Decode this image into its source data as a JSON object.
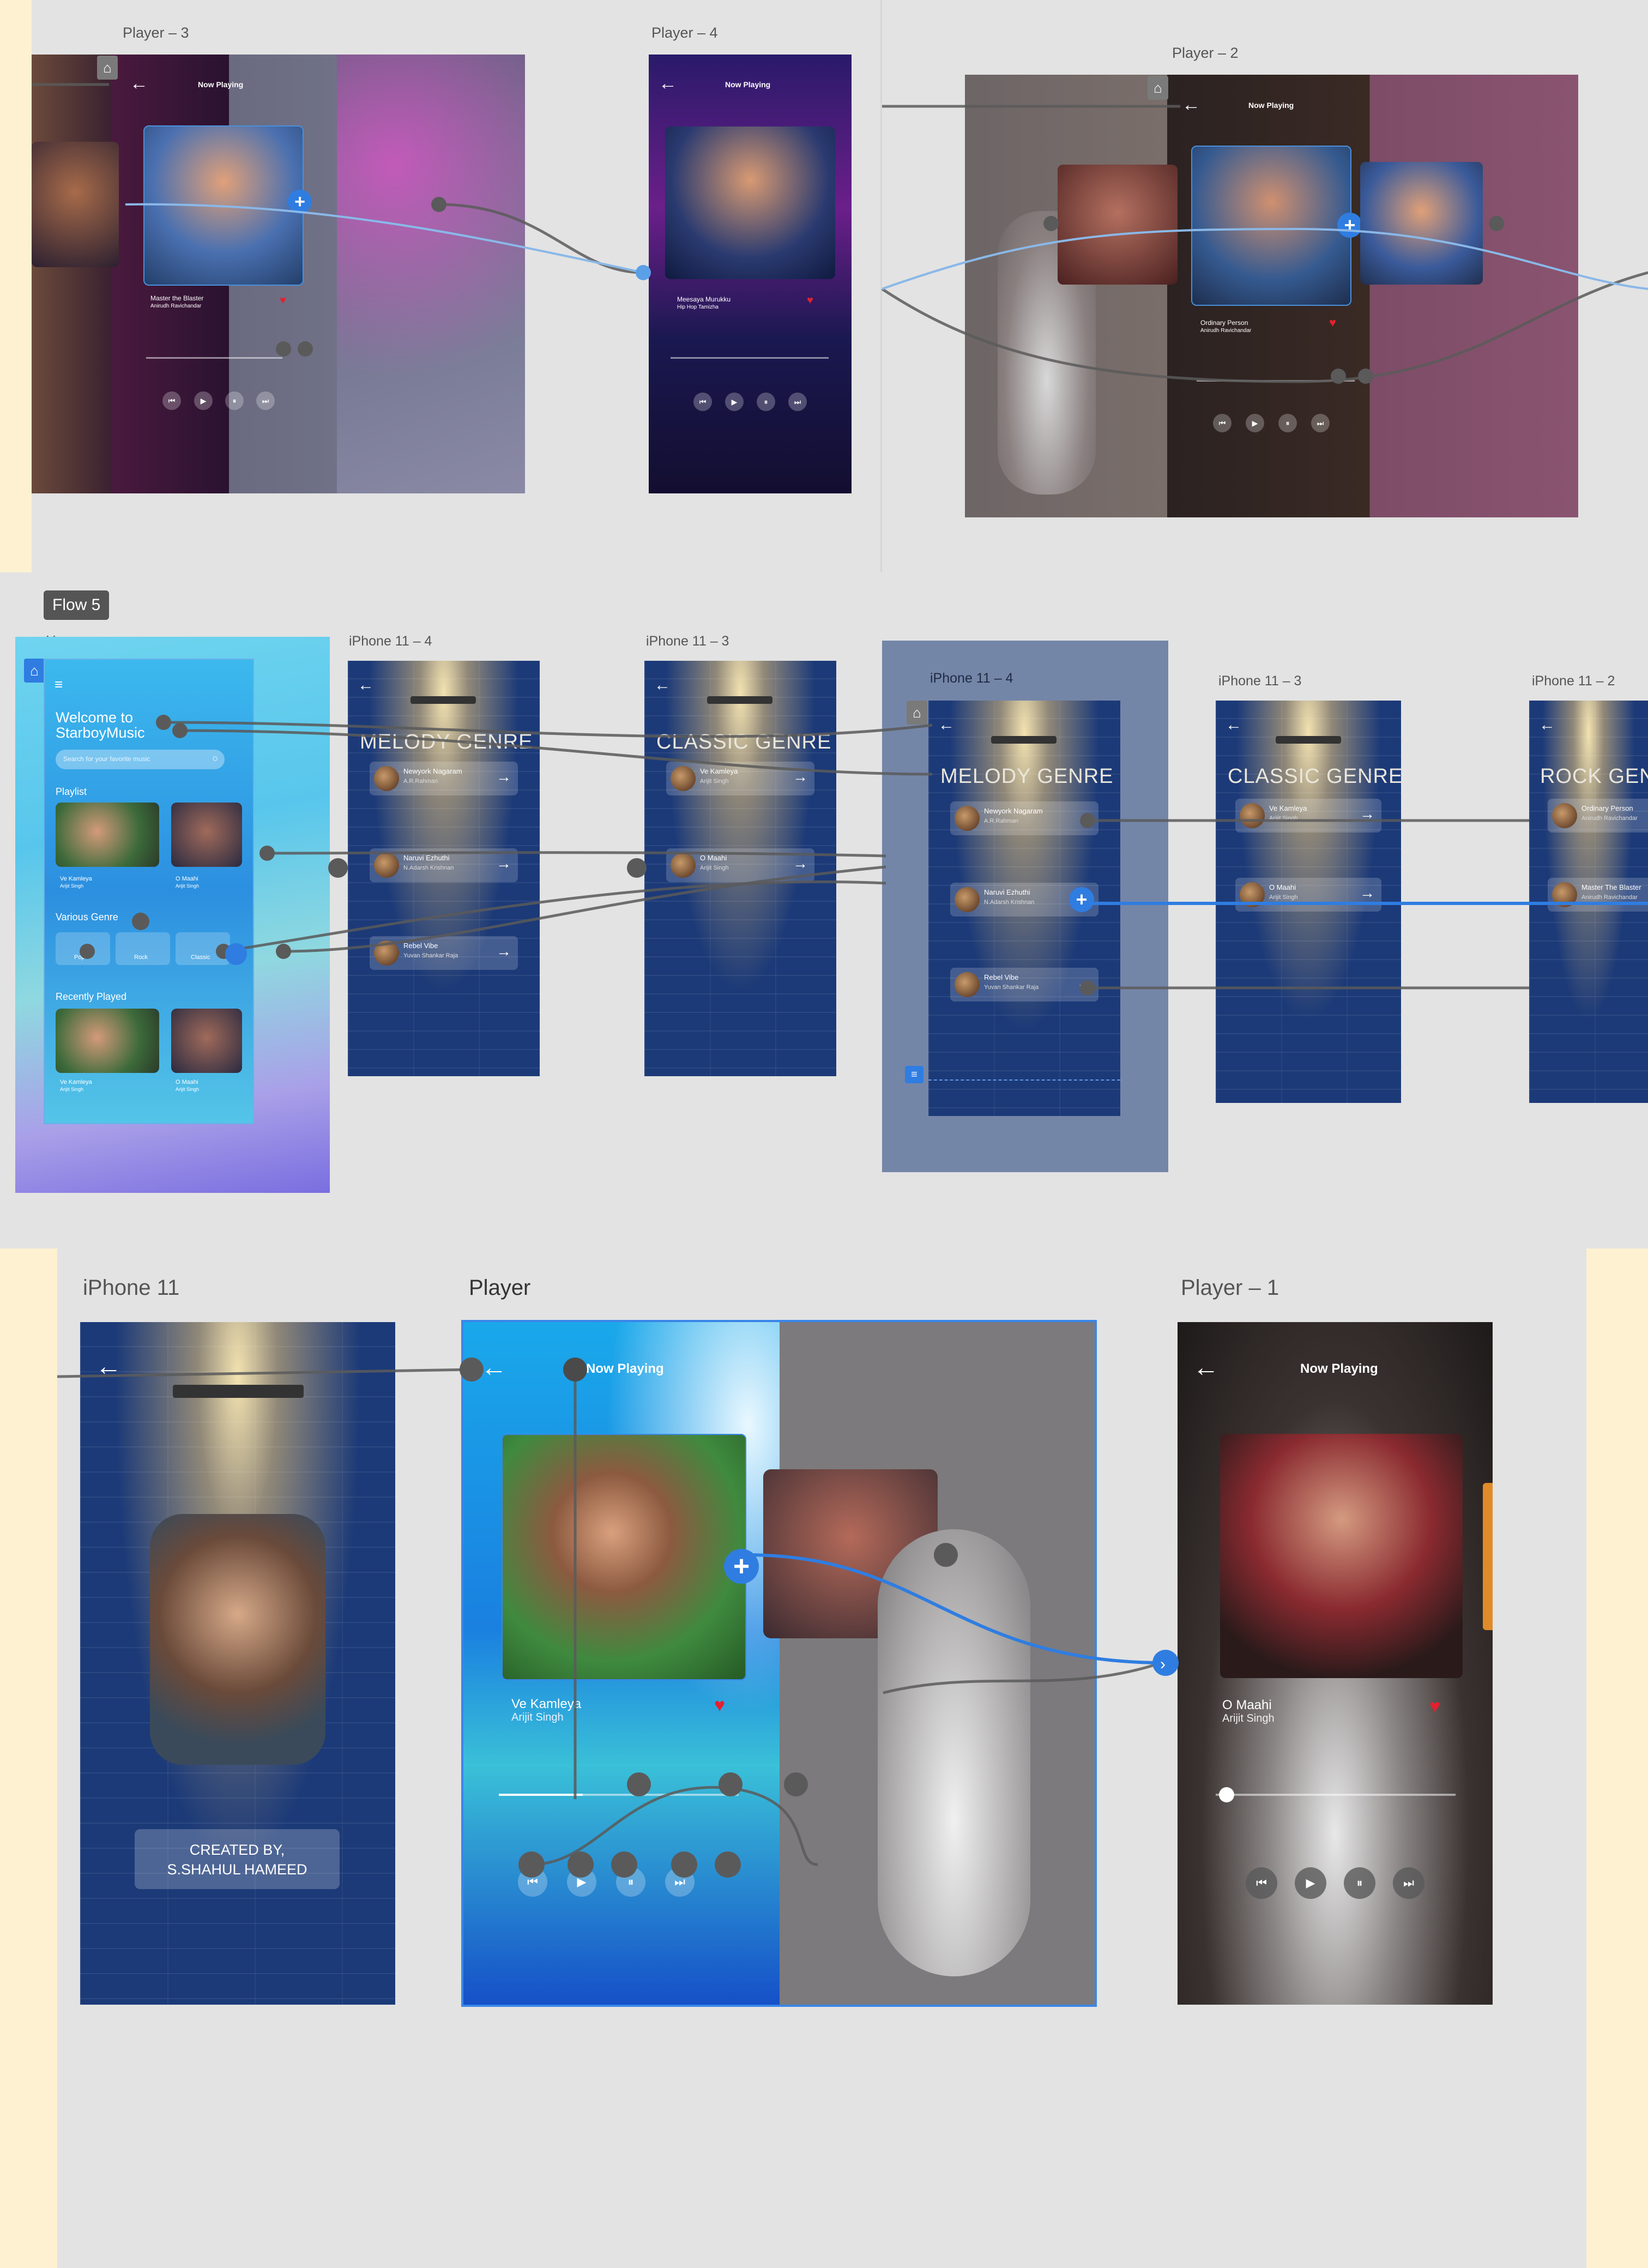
{
  "labels": {
    "player3": "Player – 3",
    "player4": "Player – 4",
    "player2": "Player – 2",
    "flow": "Flow 5",
    "home": "Home",
    "iphone11_4a": "iPhone 11 – 4",
    "iphone11_3a": "iPhone 11 – 3",
    "iphone11_4b": "iPhone 11 – 4",
    "iphone11_3b": "iPhone 11 – 3",
    "iphone11_2": "iPhone 11 – 2",
    "iphone11": "iPhone 11",
    "player": "Player",
    "player1": "Player – 1"
  },
  "now_playing": "Now Playing",
  "player3": {
    "song": "Master the Blaster",
    "artist": "Anirudh Ravichandar"
  },
  "player4": {
    "song": "Meesaya Murukku",
    "artist": "Hip Hop Tamizha"
  },
  "player2": {
    "song": "Ordinary Person",
    "artist": "Anirudh Ravichandar"
  },
  "player": {
    "song": "Ve Kamleya",
    "artist": "Arijit Singh"
  },
  "player1": {
    "song": "O Maahi",
    "artist": "Arijit Singh"
  },
  "home": {
    "welcome": "Welcome to\nStarboyMusic",
    "search_placeholder": "Search for your favorite music",
    "playlist": "Playlist",
    "various_genre": "Various Genre",
    "recently_played": "Recently Played",
    "cards": [
      {
        "song": "Ve Kamleya",
        "artist": "Arijit Singh"
      },
      {
        "song": "O Maahi",
        "artist": "Arijit Singh"
      }
    ],
    "genres": [
      "Pop",
      "Rock",
      "Classic"
    ]
  },
  "genres": {
    "melody": "MELODY GENRE",
    "classic": "CLASSIC GENRE",
    "rock": "ROCK GEN"
  },
  "melody_rows": [
    {
      "song": "Newyork Nagaram",
      "artist": "A.R.Rahman"
    },
    {
      "song": "Naruvi Ezhuthi",
      "artist": "N.Adarsh Krishnan"
    },
    {
      "song": "Rebel Vibe",
      "artist": "Yuvan Shankar Raja"
    }
  ],
  "classic_rows": [
    {
      "song": "Ve Kamleya",
      "artist": "Arijit Singh"
    },
    {
      "song": "O Maahi",
      "artist": "Arijit Singh"
    }
  ],
  "rock_rows": [
    {
      "song": "Ordinary Person",
      "artist": "Anirudh Ravichandar"
    },
    {
      "song": "Master The Blaster",
      "artist": "Anirudh Ravichandar"
    }
  ],
  "credit": "CREATED BY,\nS.SHAHUL HAMEED",
  "icons": {
    "home": "home-icon",
    "back": "back-arrow-icon",
    "plus": "plus-icon",
    "heart": "heart-icon",
    "menu": "hamburger-menu-icon"
  },
  "colors": {
    "accent": "#2f7de1",
    "heart": "#e3212f",
    "canvas": "#e3e3e3",
    "margin": "#fdf1d2"
  }
}
